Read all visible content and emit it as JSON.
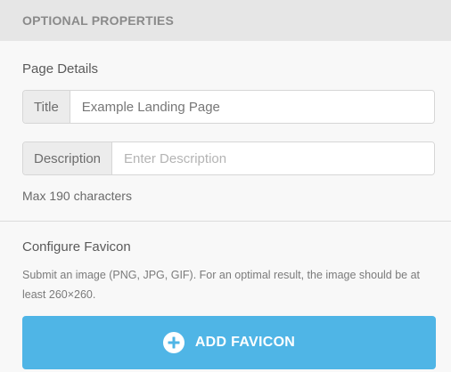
{
  "header": {
    "title": "OPTIONAL PROPERTIES"
  },
  "page_details": {
    "section_title": "Page Details",
    "title_field": {
      "label": "Title",
      "value": "Example Landing Page",
      "placeholder": ""
    },
    "description_field": {
      "label": "Description",
      "value": "",
      "placeholder": "Enter Description"
    },
    "hint": "Max 190 characters"
  },
  "favicon": {
    "section_title": "Configure Favicon",
    "description": "Submit an image (PNG, JPG, GIF). For an optimal result, the image should be at least 260×260.",
    "button_label": "ADD FAVICON",
    "button_icon": "plus-circle-icon"
  },
  "colors": {
    "accent": "#4fb5e6",
    "header_bg": "#e6e6e6",
    "panel_bg": "#f8f8f8"
  }
}
